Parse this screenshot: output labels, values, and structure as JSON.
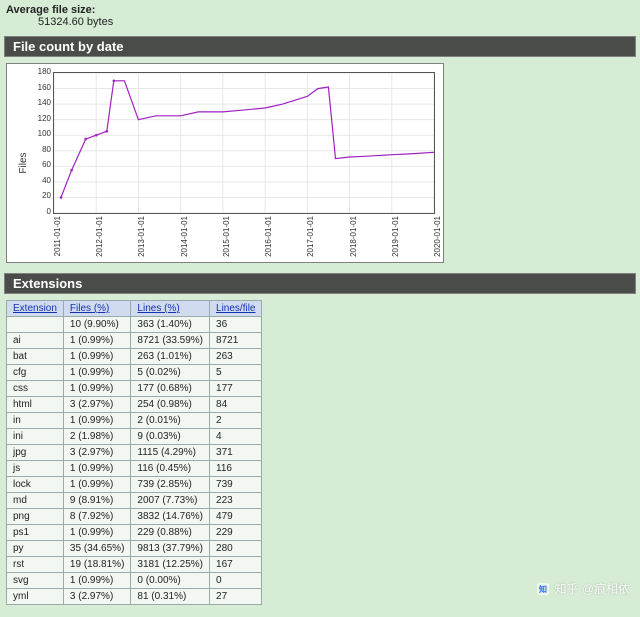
{
  "avg_label": "Average file size:",
  "avg_value": "51324.60 bytes",
  "section_file_count": "File count by date",
  "section_extensions": "Extensions",
  "chart_data": {
    "type": "line",
    "title": "",
    "xlabel": "",
    "ylabel": "Files",
    "ylim": [
      0,
      180
    ],
    "yticks": [
      0,
      20,
      40,
      60,
      80,
      100,
      120,
      140,
      160,
      180
    ],
    "xticks": [
      "2011-01-01",
      "2012-01-01",
      "2013-01-01",
      "2014-01-01",
      "2015-01-01",
      "2016-01-01",
      "2017-01-01",
      "2018-01-01",
      "2019-01-01",
      "2020-01-01"
    ],
    "series": [
      {
        "name": "files",
        "points": [
          {
            "x": "2011-03",
            "y": 20
          },
          {
            "x": "2011-06",
            "y": 55
          },
          {
            "x": "2011-10",
            "y": 95
          },
          {
            "x": "2012-01",
            "y": 100
          },
          {
            "x": "2012-04",
            "y": 105
          },
          {
            "x": "2012-06",
            "y": 170
          },
          {
            "x": "2012-09",
            "y": 170
          },
          {
            "x": "2013-01",
            "y": 120
          },
          {
            "x": "2013-06",
            "y": 125
          },
          {
            "x": "2014-01",
            "y": 125
          },
          {
            "x": "2014-06",
            "y": 130
          },
          {
            "x": "2015-01",
            "y": 130
          },
          {
            "x": "2015-06",
            "y": 132
          },
          {
            "x": "2016-01",
            "y": 135
          },
          {
            "x": "2016-06",
            "y": 140
          },
          {
            "x": "2017-01",
            "y": 150
          },
          {
            "x": "2017-04",
            "y": 160
          },
          {
            "x": "2017-07",
            "y": 162
          },
          {
            "x": "2017-09",
            "y": 70
          },
          {
            "x": "2018-01",
            "y": 72
          },
          {
            "x": "2018-06",
            "y": 73
          },
          {
            "x": "2019-01",
            "y": 75
          },
          {
            "x": "2019-06",
            "y": 76
          },
          {
            "x": "2020-01",
            "y": 78
          }
        ]
      }
    ]
  },
  "ext_headers": [
    "Extension",
    "Files (%)",
    "Lines (%)",
    "Lines/file"
  ],
  "ext_rows": [
    {
      "ext": "",
      "files": "10 (9.90%)",
      "lines": "363 (1.40%)",
      "lpf": "36"
    },
    {
      "ext": "ai",
      "files": "1 (0.99%)",
      "lines": "8721 (33.59%)",
      "lpf": "8721"
    },
    {
      "ext": "bat",
      "files": "1 (0.99%)",
      "lines": "263 (1.01%)",
      "lpf": "263"
    },
    {
      "ext": "cfg",
      "files": "1 (0.99%)",
      "lines": "5 (0.02%)",
      "lpf": "5"
    },
    {
      "ext": "css",
      "files": "1 (0.99%)",
      "lines": "177 (0.68%)",
      "lpf": "177"
    },
    {
      "ext": "html",
      "files": "3 (2.97%)",
      "lines": "254 (0.98%)",
      "lpf": "84"
    },
    {
      "ext": "in",
      "files": "1 (0.99%)",
      "lines": "2 (0.01%)",
      "lpf": "2"
    },
    {
      "ext": "ini",
      "files": "2 (1.98%)",
      "lines": "9 (0.03%)",
      "lpf": "4"
    },
    {
      "ext": "jpg",
      "files": "3 (2.97%)",
      "lines": "1115 (4.29%)",
      "lpf": "371"
    },
    {
      "ext": "js",
      "files": "1 (0.99%)",
      "lines": "116 (0.45%)",
      "lpf": "116"
    },
    {
      "ext": "lock",
      "files": "1 (0.99%)",
      "lines": "739 (2.85%)",
      "lpf": "739"
    },
    {
      "ext": "md",
      "files": "9 (8.91%)",
      "lines": "2007 (7.73%)",
      "lpf": "223"
    },
    {
      "ext": "png",
      "files": "8 (7.92%)",
      "lines": "3832 (14.76%)",
      "lpf": "479"
    },
    {
      "ext": "ps1",
      "files": "1 (0.99%)",
      "lines": "229 (0.88%)",
      "lpf": "229"
    },
    {
      "ext": "py",
      "files": "35 (34.65%)",
      "lines": "9813 (37.79%)",
      "lpf": "280"
    },
    {
      "ext": "rst",
      "files": "19 (18.81%)",
      "lines": "3181 (12.25%)",
      "lpf": "167"
    },
    {
      "ext": "svg",
      "files": "1 (0.99%)",
      "lines": "0 (0.00%)",
      "lpf": "0"
    },
    {
      "ext": "yml",
      "files": "3 (2.97%)",
      "lines": "81 (0.31%)",
      "lpf": "27"
    }
  ],
  "watermark": "知乎 @痕相依"
}
